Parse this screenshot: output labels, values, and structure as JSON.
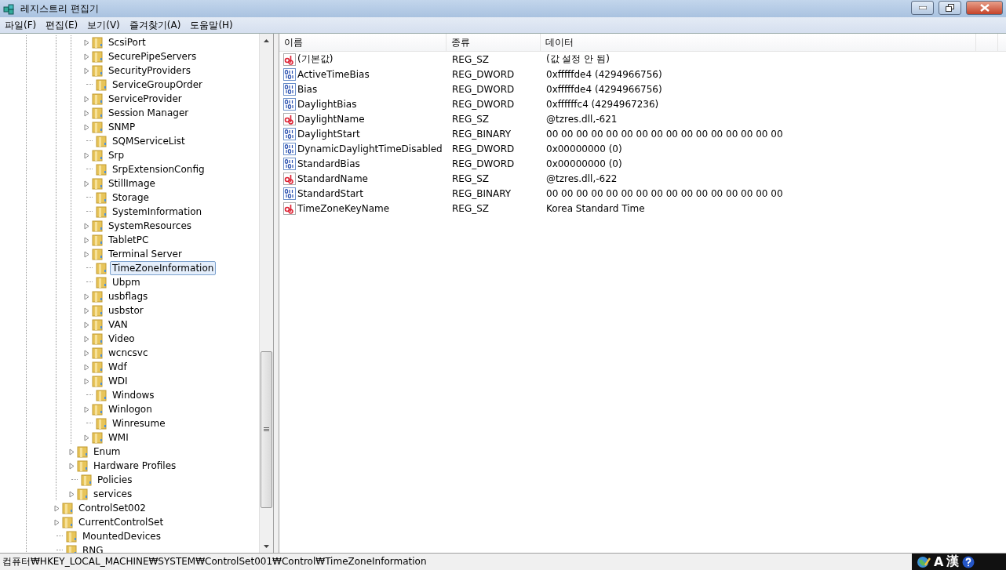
{
  "window": {
    "title": "레지스트리 편집기"
  },
  "menu": [
    "파일(F)",
    "편집(E)",
    "보기(V)",
    "즐겨찾기(A)",
    "도움말(H)"
  ],
  "tree": [
    {
      "children": [
        {
          "children": [
            {
              "label": "ScsiPort",
              "expander": true,
              "selected": false
            },
            {
              "label": "SecurePipeServers",
              "expander": true,
              "selected": false
            },
            {
              "label": "SecurityProviders",
              "expander": true,
              "selected": false
            },
            {
              "label": "ServiceGroupOrder",
              "expander": false,
              "selected": false
            },
            {
              "label": "ServiceProvider",
              "expander": true,
              "selected": false
            },
            {
              "label": "Session Manager",
              "expander": true,
              "selected": false
            },
            {
              "label": "SNMP",
              "expander": true,
              "selected": false
            },
            {
              "label": "SQMServiceList",
              "expander": false,
              "selected": false
            },
            {
              "label": "Srp",
              "expander": true,
              "selected": false
            },
            {
              "label": "SrpExtensionConfig",
              "expander": false,
              "selected": false
            },
            {
              "label": "StillImage",
              "expander": true,
              "selected": false
            },
            {
              "label": "Storage",
              "expander": false,
              "selected": false
            },
            {
              "label": "SystemInformation",
              "expander": false,
              "selected": false
            },
            {
              "label": "SystemResources",
              "expander": true,
              "selected": false
            },
            {
              "label": "TabletPC",
              "expander": true,
              "selected": false
            },
            {
              "label": "Terminal Server",
              "expander": true,
              "selected": false
            },
            {
              "label": "TimeZoneInformation",
              "expander": false,
              "selected": true
            },
            {
              "label": "Ubpm",
              "expander": false,
              "selected": false
            },
            {
              "label": "usbflags",
              "expander": true,
              "selected": false
            },
            {
              "label": "usbstor",
              "expander": true,
              "selected": false
            },
            {
              "label": "VAN",
              "expander": true,
              "selected": false
            },
            {
              "label": "Video",
              "expander": true,
              "selected": false
            },
            {
              "label": "wcncsvc",
              "expander": true,
              "selected": false
            },
            {
              "label": "Wdf",
              "expander": true,
              "selected": false
            },
            {
              "label": "WDI",
              "expander": true,
              "selected": false
            },
            {
              "label": "Windows",
              "expander": false,
              "selected": false
            },
            {
              "label": "Winlogon",
              "expander": true,
              "selected": false
            },
            {
              "label": "Winresume",
              "expander": false,
              "selected": false
            },
            {
              "label": "WMI",
              "expander": true,
              "selected": false
            }
          ]
        },
        {
          "label": "Enum",
          "expander": true,
          "selected": false
        },
        {
          "label": "Hardware Profiles",
          "expander": true,
          "selected": false
        },
        {
          "label": "Policies",
          "expander": false,
          "selected": false
        },
        {
          "label": "services",
          "expander": true,
          "selected": false
        }
      ]
    },
    {
      "label": "ControlSet002",
      "expander": true,
      "selected": false
    },
    {
      "label": "CurrentControlSet",
      "expander": true,
      "selected": false
    },
    {
      "label": "MountedDevices",
      "expander": false,
      "selected": false
    },
    {
      "label": "RNG",
      "expander": false,
      "selected": false
    }
  ],
  "table": {
    "columns": [
      "이름",
      "종류",
      "데이터"
    ],
    "rows": [
      {
        "kind": "string",
        "name": "(기본값)",
        "type": "REG_SZ",
        "data": "(값 설정 안 됨)"
      },
      {
        "kind": "binary",
        "name": "ActiveTimeBias",
        "type": "REG_DWORD",
        "data": "0xfffffde4 (4294966756)"
      },
      {
        "kind": "binary",
        "name": "Bias",
        "type": "REG_DWORD",
        "data": "0xfffffde4 (4294966756)"
      },
      {
        "kind": "binary",
        "name": "DaylightBias",
        "type": "REG_DWORD",
        "data": "0xffffffc4 (4294967236)"
      },
      {
        "kind": "string",
        "name": "DaylightName",
        "type": "REG_SZ",
        "data": "@tzres.dll,-621"
      },
      {
        "kind": "binary",
        "name": "DaylightStart",
        "type": "REG_BINARY",
        "data": "00 00 00 00 00 00 00 00 00 00 00 00 00 00 00 00"
      },
      {
        "kind": "binary",
        "name": "DynamicDaylightTimeDisabled",
        "type": "REG_DWORD",
        "data": "0x00000000 (0)"
      },
      {
        "kind": "binary",
        "name": "StandardBias",
        "type": "REG_DWORD",
        "data": "0x00000000 (0)"
      },
      {
        "kind": "string",
        "name": "StandardName",
        "type": "REG_SZ",
        "data": "@tzres.dll,-622"
      },
      {
        "kind": "binary",
        "name": "StandardStart",
        "type": "REG_BINARY",
        "data": "00 00 00 00 00 00 00 00 00 00 00 00 00 00 00 00"
      },
      {
        "kind": "string",
        "name": "TimeZoneKeyName",
        "type": "REG_SZ",
        "data": "Korea Standard Time"
      }
    ]
  },
  "status_bar": "컴퓨터₩HKEY_LOCAL_MACHINE₩SYSTEM₩ControlSet001₩Control₩TimeZoneInformation",
  "ime_bar": [
    "A",
    "漢"
  ]
}
